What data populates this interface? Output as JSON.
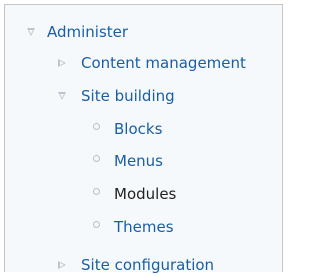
{
  "menu": {
    "root": {
      "label": "Administer",
      "marker": "expanded-triangle-icon"
    },
    "content_management": {
      "label": "Content management",
      "marker": "collapsed-triangle-icon"
    },
    "site_building": {
      "label": "Site building",
      "marker": "expanded-triangle-icon",
      "children": [
        {
          "label": "Blocks",
          "marker": "bullet-circle-icon",
          "active": false
        },
        {
          "label": "Menus",
          "marker": "bullet-circle-icon",
          "active": false
        },
        {
          "label": "Modules",
          "marker": "bullet-circle-icon",
          "active": true
        },
        {
          "label": "Themes",
          "marker": "bullet-circle-icon",
          "active": false
        }
      ]
    },
    "site_configuration": {
      "label": "Site configuration",
      "marker": "collapsed-triangle-icon"
    }
  },
  "colors": {
    "link": "#1a5ea3",
    "active_link": "#222222",
    "panel_background": "#f6f9fc",
    "panel_border": "#c6c6c6",
    "marker": "#bcc6cf"
  }
}
